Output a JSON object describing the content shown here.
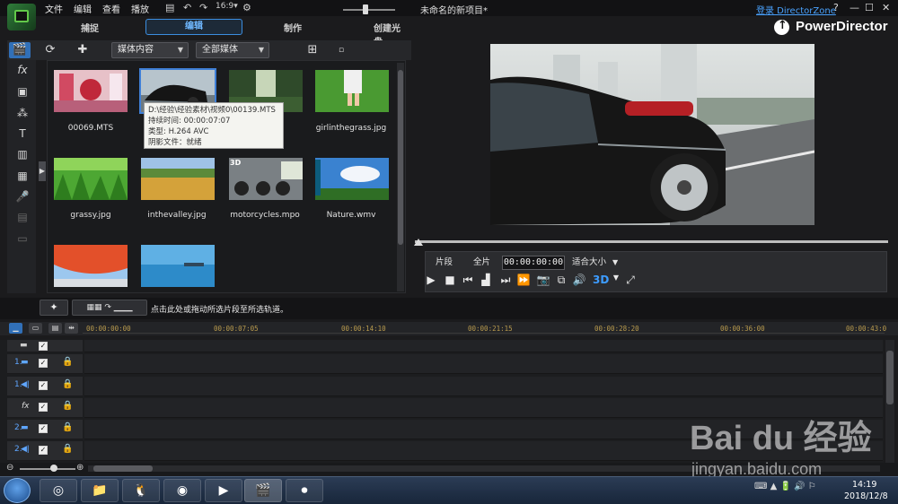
{
  "menu": {
    "file": "文件",
    "edit": "编辑",
    "view": "查看",
    "play": "播放",
    "title": "未命名的新项目*",
    "login": "登录 DirectorZone",
    "help": "?",
    "minimize": "—",
    "maximize": "☐",
    "close": "✕"
  },
  "modes": {
    "capture": "捕捉",
    "edit": "编辑",
    "produce": "制作",
    "create_disc": "创建光盘"
  },
  "brand": "PowerDirector",
  "library": {
    "filter_label": "媒体内容",
    "type_label": "全部媒体",
    "items": [
      {
        "caption": "00069.MTS"
      },
      {
        "caption": ""
      },
      {
        "caption": ""
      },
      {
        "caption": "girlinthegrass.jpg"
      },
      {
        "caption": "grassy.jpg"
      },
      {
        "caption": "inthevalley.jpg"
      },
      {
        "caption": "motorcycles.mpo",
        "badge": "3D"
      },
      {
        "caption": "Nature.wmv"
      },
      {
        "caption": ""
      },
      {
        "caption": ""
      }
    ],
    "tooltip": {
      "path": "D:\\经验\\经验素材\\视频0\\00139.MTS",
      "duration": "持续时间: 00:00:07:07",
      "type": "类型: H.264 AVC",
      "shadow": "阴影文件：就绪"
    }
  },
  "preview": {
    "clip_btn": "片段",
    "movie_btn": "全片",
    "timecode": "00:00:00:00",
    "fit_label": "适合大小",
    "btn_3d": "3D"
  },
  "hint": "点击此处或拖动所选片段至所选轨道。",
  "timeline": {
    "ticks": [
      "00:00:00:00",
      "00:00:07:05",
      "00:00:14:10",
      "00:00:21:15",
      "00:00:28:20",
      "00:00:36:00",
      "00:00:43:0"
    ],
    "tracks": [
      {
        "label": "1."
      },
      {
        "label": "1."
      },
      {
        "label": "fx"
      },
      {
        "label": "2."
      },
      {
        "label": "2."
      }
    ]
  },
  "taskbar": {
    "time": "14:19",
    "date": "2018/12/8"
  },
  "watermark": {
    "logo": "Bai du 经验",
    "url": "jingyan.baidu.com"
  },
  "colors": {
    "accent": "#3b8de0",
    "timeline_tick": "#b99b4e",
    "login_link": "#4aa3ff"
  }
}
